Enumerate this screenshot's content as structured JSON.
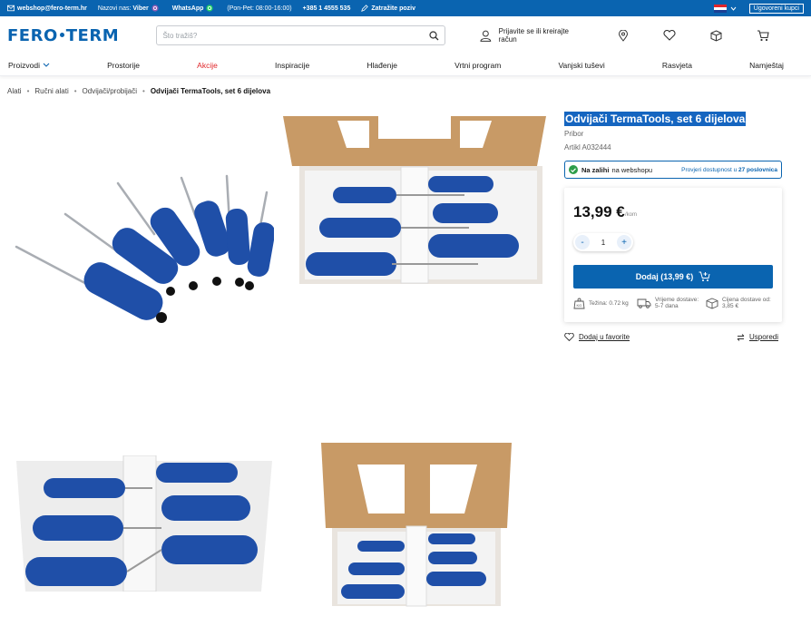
{
  "topbar": {
    "email": "webshop@fero-term.hr",
    "call_us_prefix": "Nazovi nas:",
    "viber": "Viber",
    "whatsapp": "WhatsApp",
    "hours": "(Pon-Pet: 08:00-16:00)",
    "phone": "+385 1 4555 535",
    "callback": "Zatražite poziv",
    "contract_buyers": "Ugovoreni kupci"
  },
  "header": {
    "logo_left": "FERO",
    "logo_right": "TERM",
    "search_placeholder": "Što tražiš?",
    "login_label": "Prijavite se ili kreirajte račun"
  },
  "nav": {
    "items": [
      "Proizvodi",
      "Prostorije",
      "Akcije",
      "Inspiracije",
      "Hlađenje",
      "Vrtni program",
      "Vanjski tuševi",
      "Rasvjeta",
      "Namještaj"
    ]
  },
  "breadcrumb": [
    "Alati",
    "Ručni alati",
    "Odvijači/probijači",
    "Odvijači TermaTools, set 6 dijelova"
  ],
  "product": {
    "title": "Odvijači TermaTools, set 6 dijelova",
    "category": "Pribor",
    "sku": "Artikl A032444",
    "stock_bold": "Na zalihi",
    "stock_rest": "na webshopu",
    "availability_text": "Provjeri dostupnost u",
    "availability_count": "27 poslovnica",
    "price": "13,99 €",
    "price_unit": "/kom",
    "quantity": "1",
    "add_button": "Dodaj (13,99 €)",
    "weight_label": "Težina:",
    "weight_value": "0.72 kg",
    "delivery_time_label": "Vrijeme dostave:",
    "delivery_time_value": "5-7 dana",
    "delivery_price_label": "Cijena dostave od:",
    "delivery_price_value": "3,85 €",
    "favorite_link": "Dodaj u favorite",
    "compare_link": "Usporedi"
  },
  "colors": {
    "brand_blue": "#0a64b0",
    "sale_red": "#e0262a",
    "stock_green": "#2e9d4a"
  }
}
